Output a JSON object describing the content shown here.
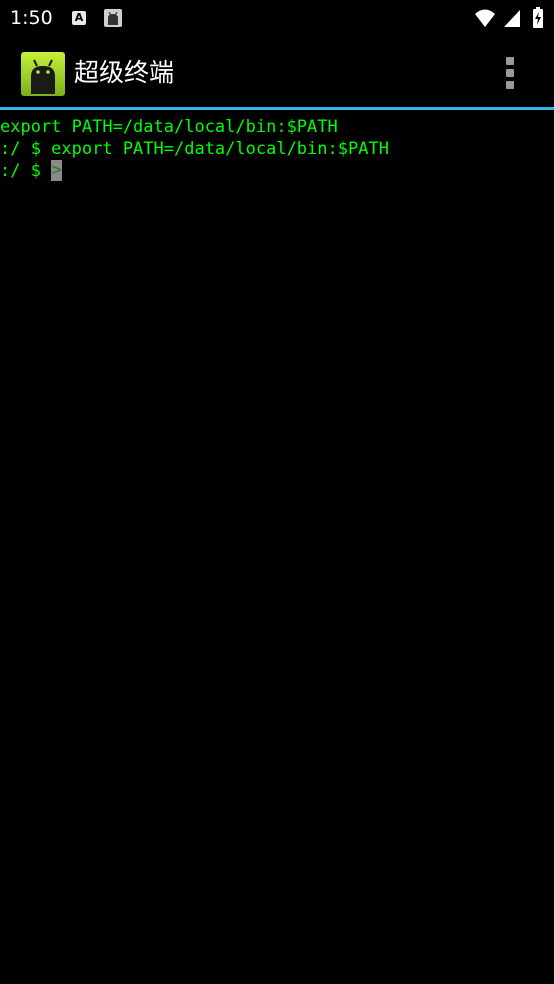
{
  "status_bar": {
    "time": "1:50",
    "notification_letter": "A",
    "icons": [
      "accessibility-a-icon",
      "android-app-icon",
      "wifi-icon",
      "signal-icon",
      "battery-icon"
    ]
  },
  "app_bar": {
    "title": "超级终端",
    "overflow_icon": "more-vert-icon",
    "accent_color": "#33b5e5"
  },
  "terminal": {
    "text_color": "#00ff00",
    "lines": [
      "export PATH=/data/local/bin:$PATH",
      ":/ $ export PATH=/data/local/bin:$PATH",
      ":/ $ "
    ],
    "cursor_char": ">"
  }
}
